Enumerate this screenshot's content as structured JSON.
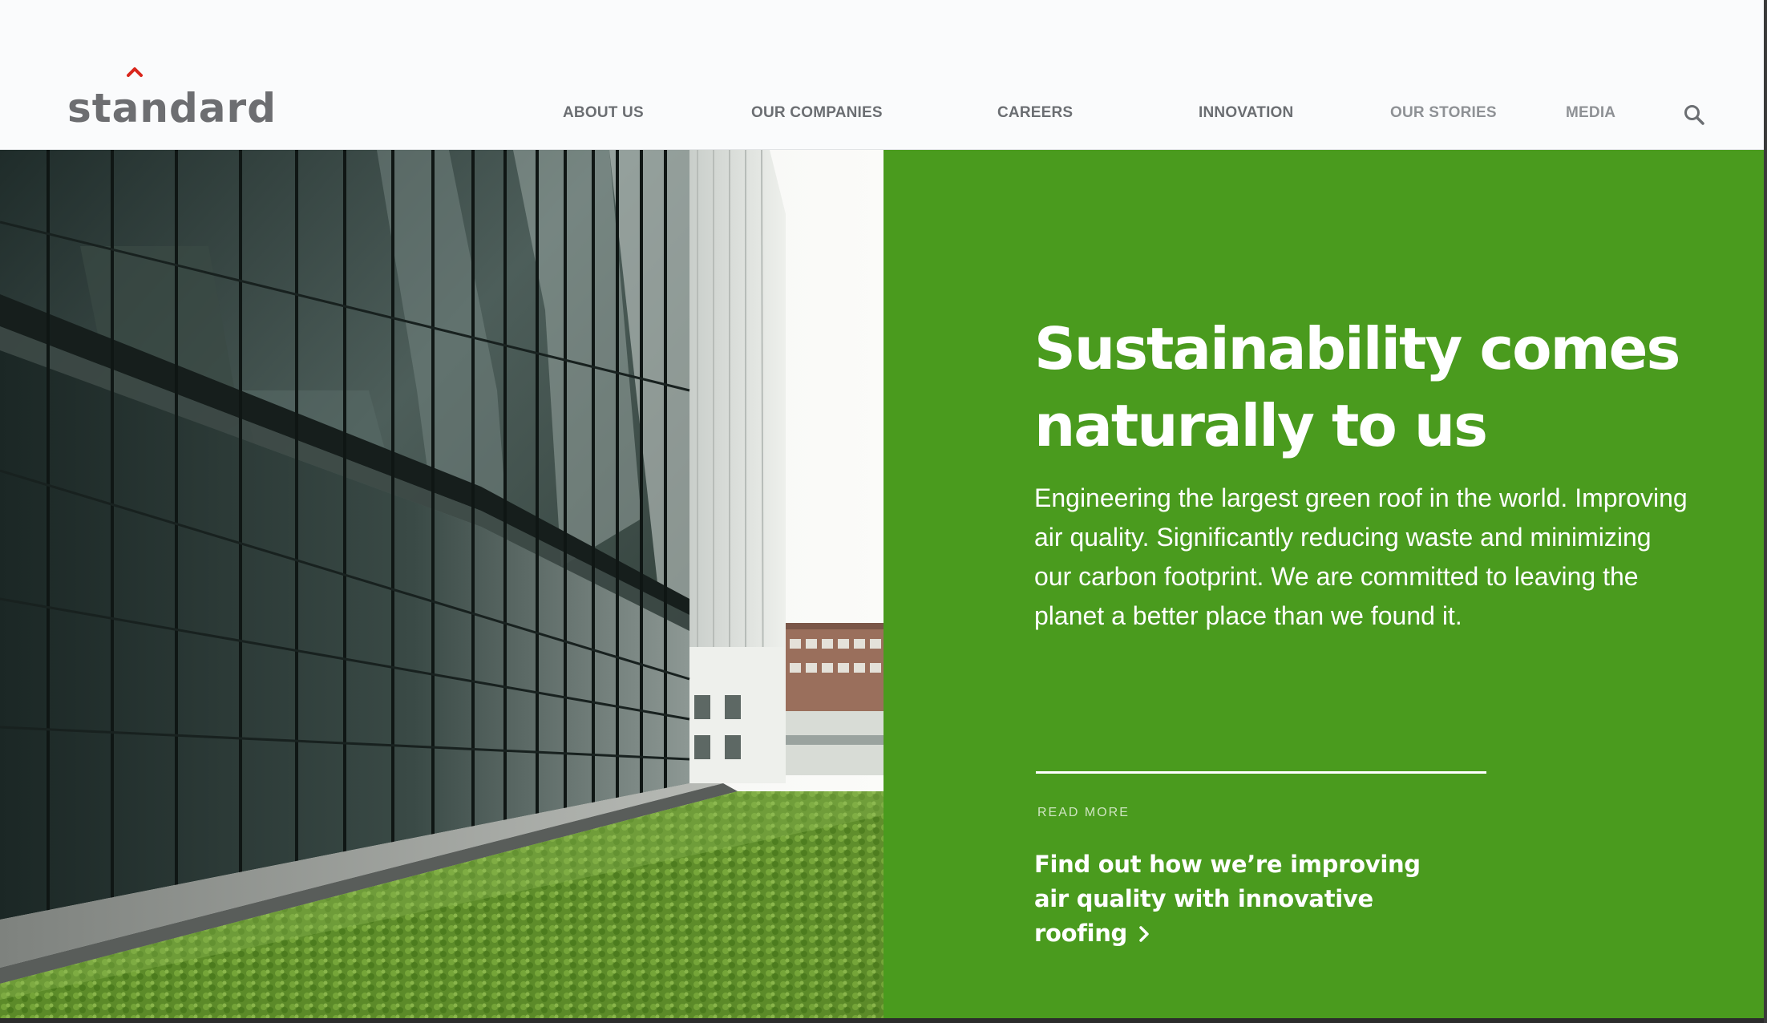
{
  "brand": {
    "logo_text": "standard",
    "accent_color": "#d9261c"
  },
  "nav": {
    "items": [
      {
        "label": "ABOUT US"
      },
      {
        "label": "OUR COMPANIES"
      },
      {
        "label": "CAREERS"
      },
      {
        "label": "INNOVATION"
      },
      {
        "label": "OUR STORIES"
      },
      {
        "label": "MEDIA"
      }
    ],
    "search_icon": "search-icon"
  },
  "hero": {
    "panel_color": "#4a9b1e",
    "headline": "Sustainability comes naturally to us",
    "body": "Engineering the largest green roof in the world. Improving air quality. Significantly reducing waste and minimizing our carbon footprint. We are committed to leaving the planet a better place than we found it.",
    "read_more_label": "READ MORE",
    "cta_text": "Find out how we’re improving air quality with innovative roofing",
    "cta_icon": "chevron-right-icon"
  }
}
